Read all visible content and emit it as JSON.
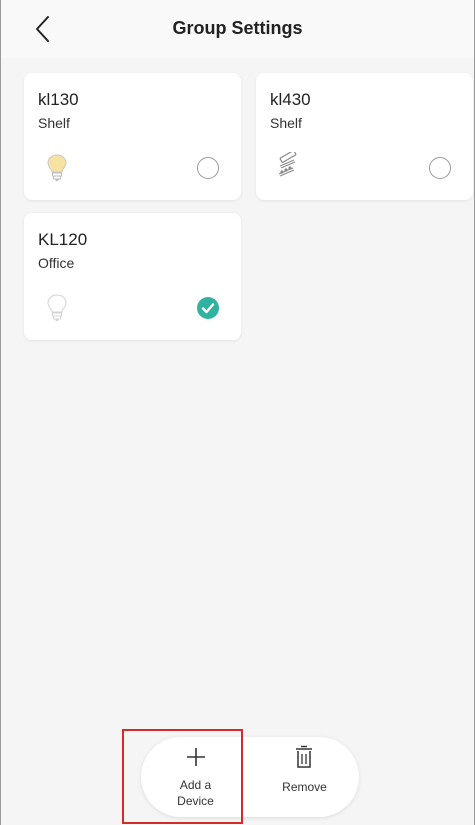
{
  "header": {
    "title": "Group Settings",
    "back_icon": "chevron-left-icon"
  },
  "devices": [
    {
      "name": "kl130",
      "room": "Shelf",
      "icon": "bulb-warm-icon",
      "selected": false
    },
    {
      "name": "kl430",
      "room": "Shelf",
      "icon": "light-strip-icon",
      "selected": false
    },
    {
      "name": "KL120",
      "room": "Office",
      "icon": "bulb-white-icon",
      "selected": true
    }
  ],
  "actions": {
    "add_icon": "plus-icon",
    "add_label_line1": "Add a",
    "add_label_line2": "Device",
    "remove_icon": "trash-icon",
    "remove_label": "Remove"
  },
  "colors": {
    "check": "#2fb3a0",
    "highlight": "#d42a2a",
    "warm_bulb": "#f6e3a1"
  }
}
